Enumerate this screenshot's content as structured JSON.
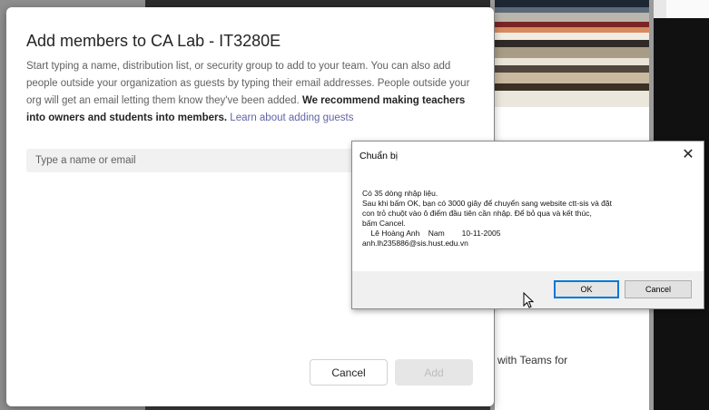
{
  "dialog": {
    "title": "Add members to CA Lab - IT3280E",
    "description_plain": "Start typing a name, distribution list, or security group to add to your team. You can also add people outside your organization as guests by typing their email addresses. People outside your org will get an email letting them know they've been added. ",
    "description_bold": "We recommend making teachers into owners and students into members.",
    "learn_link": "Learn about adding guests",
    "input_placeholder": "Type a name or email",
    "cancel_label": "Cancel",
    "add_label": "Add"
  },
  "background": {
    "partial_text": "with Teams for"
  },
  "msgbox": {
    "title": "Chuẩn bị",
    "close_glyph": "✕",
    "lines": [
      "Có 35 dòng nhập liệu.",
      "Sau khi bấm OK, bạn có 3000 giây để chuyển sang website ctt-sis và đặt",
      "con trỏ chuột vào ô điểm đầu tiên cần nhập. Để bỏ qua và kết thúc,",
      "bấm Cancel.",
      "    Lê Hoàng Anh    Nam        10-11-2005",
      "anh.lh235886@sis.hust.edu.vn"
    ],
    "ok_label": "OK",
    "cancel_label": "Cancel"
  }
}
